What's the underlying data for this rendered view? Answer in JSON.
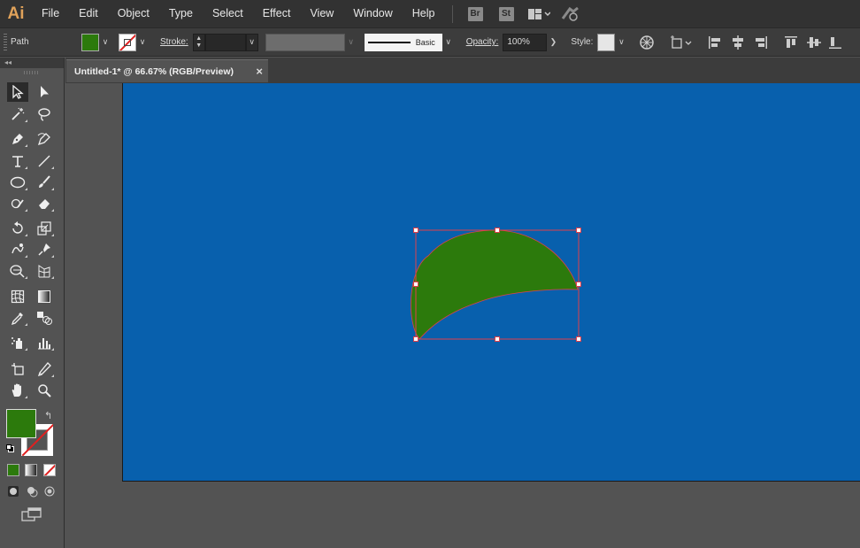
{
  "app": {
    "logo": "Ai"
  },
  "menu": {
    "items": [
      "File",
      "Edit",
      "Object",
      "Type",
      "Select",
      "Effect",
      "View",
      "Window",
      "Help"
    ],
    "bridge_badge": "Br",
    "stock_badge": "St"
  },
  "control_bar": {
    "selection_type": "Path",
    "fill_color": "#2c7a0c",
    "stroke_label": "Stroke:",
    "stroke_weight": "",
    "stroke_style": "Basic",
    "opacity_label": "Opacity:",
    "opacity_value": "100%",
    "style_label": "Style:"
  },
  "document": {
    "tab_title": "Untitled-1* @ 66.67% (RGB/Preview)",
    "close_glyph": "×"
  },
  "canvas": {
    "artboard_color": "#0860ad",
    "shape_fill": "#2c7a0c",
    "selection_color": "#e0404a"
  },
  "toolbar": {
    "collapse_glyph": "◂◂",
    "swap_glyph": "↰"
  }
}
